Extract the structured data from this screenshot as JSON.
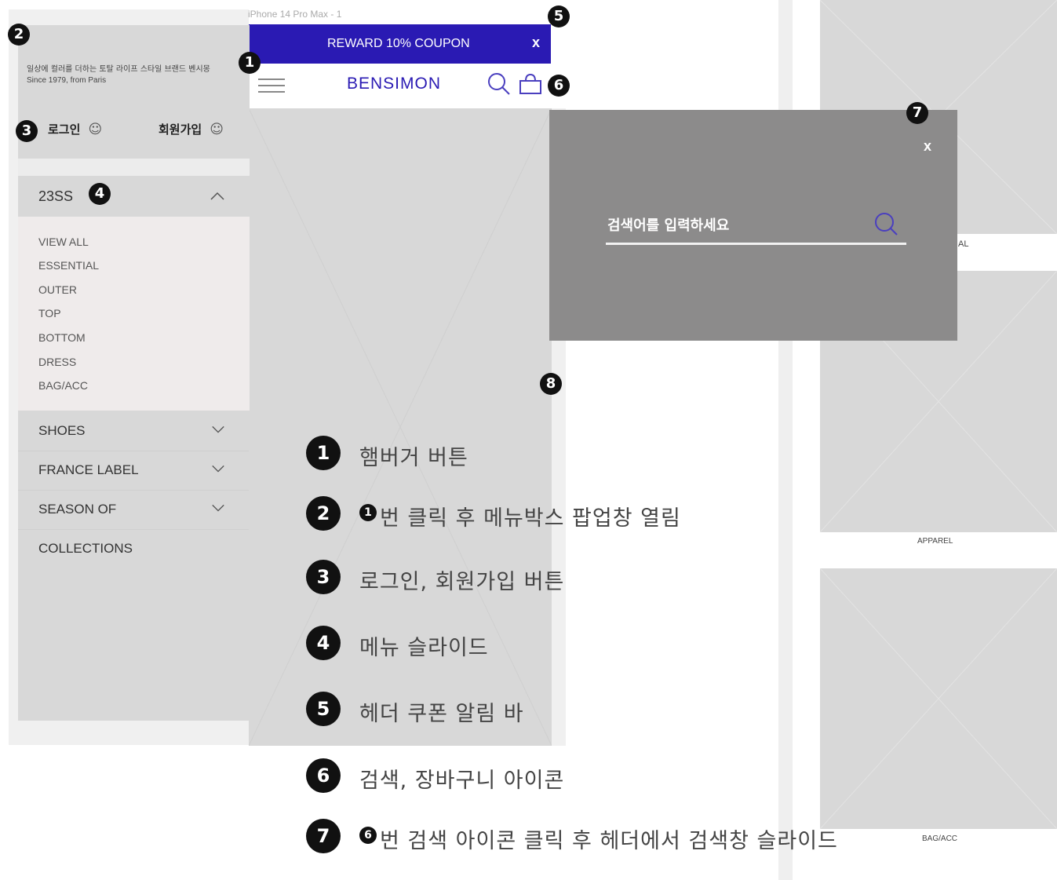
{
  "frame_label": "iPhone 14 Pro Max - 1",
  "coupon_bar": {
    "text": "REWARD 10% COUPON",
    "close": "x"
  },
  "header": {
    "logo": "BENSIMON"
  },
  "menu_box": {
    "brand_copy": "일상에 컬러를 더하는 토탈 라이프 스타일 브랜드 벤시몽",
    "since_line": "Since 1979,  from Paris",
    "login": "로그인",
    "signup": "회원가입",
    "open_section": "23SS",
    "sub_items": [
      "VIEW ALL",
      "ESSENTIAL",
      "OUTER",
      "TOP",
      "BOTTOM",
      "DRESS",
      "BAG/ACC"
    ],
    "sections": [
      "SHOES",
      "FRANCE LABEL",
      "SEASON OF",
      "COLLECTIONS"
    ]
  },
  "search_popup": {
    "close": "x",
    "placeholder": "검색어를 입력하세요"
  },
  "category_labels": {
    "partial": "AL",
    "apparel": "APPAREL",
    "bag_acc": "BAG/ACC"
  },
  "markers": {
    "m1": "1",
    "m2": "2",
    "m3": "3",
    "m4": "4",
    "m5": "5",
    "m6": "6",
    "m7": "7",
    "m8": "8"
  },
  "legend": [
    {
      "num": "1",
      "text": "햄버거 버튼",
      "inline": "",
      "text_after": ""
    },
    {
      "num": "2",
      "text": "",
      "inline": "1",
      "text_after": "번 클릭 후 메뉴박스 팝업창 열림"
    },
    {
      "num": "3",
      "text": "로그인, 회원가입 버튼",
      "inline": "",
      "text_after": ""
    },
    {
      "num": "4",
      "text": "메뉴 슬라이드",
      "inline": "",
      "text_after": ""
    },
    {
      "num": "5",
      "text": "헤더 쿠폰 알림 바",
      "inline": "",
      "text_after": ""
    },
    {
      "num": "6",
      "text": "검색, 장바구니 아이콘",
      "inline": "",
      "text_after": ""
    },
    {
      "num": "7",
      "text": "",
      "inline": "6",
      "text_after": "번 검색 아이콘 클릭 후 헤더에서 검색창 슬라이드"
    }
  ],
  "colors": {
    "coupon_bar": "#2a1ab3",
    "accent_search": "#4a3fbf",
    "panel_gray": "#d8d8d8",
    "sub_menu_bg": "#efebeb",
    "popup_gray": "#8c8b8b"
  }
}
